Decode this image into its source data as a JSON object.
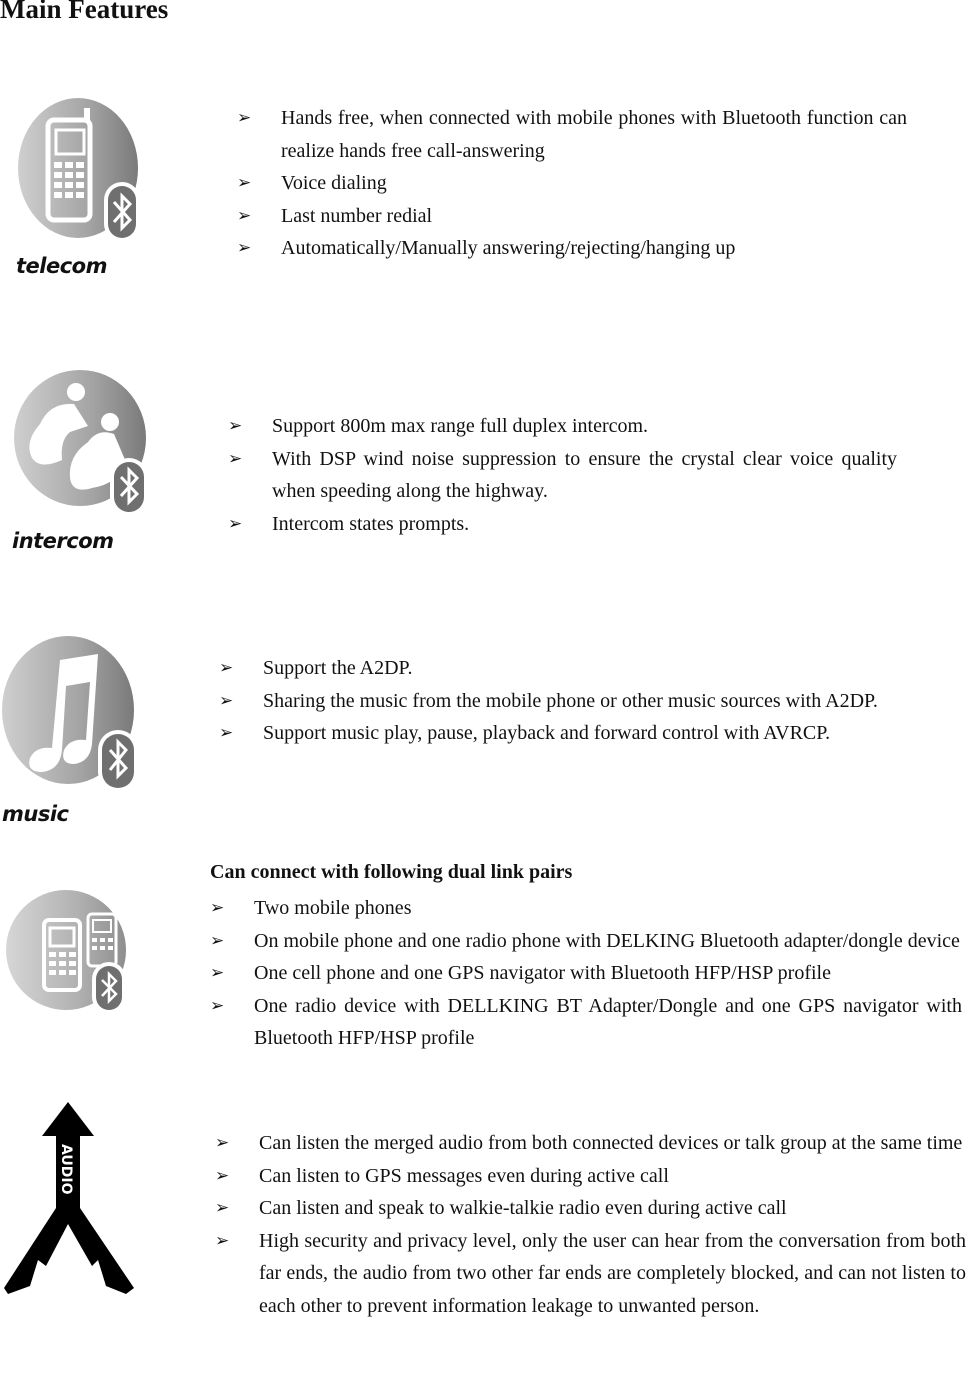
{
  "page": {
    "title": "Main Features"
  },
  "sections": [
    {
      "icon": "telecom-phone-bluetooth-icon",
      "icon_label": "telecom",
      "bullets": [
        "Hands free, when connected with mobile phones with Bluetooth function can realize hands free call-answering",
        "Voice dialing",
        "Last number redial",
        "Automatically/Manually answering/rejecting/hanging up"
      ]
    },
    {
      "icon": "intercom-riders-bluetooth-icon",
      "icon_label": "intercom",
      "bullets": [
        "Support 800m max range full duplex intercom.",
        "With DSP wind noise suppression to ensure the crystal clear voice quality when speeding along the highway.",
        "Intercom states prompts."
      ]
    },
    {
      "icon": "music-note-bluetooth-icon",
      "icon_label": "music",
      "bullets": [
        "Support the A2DP.",
        "Sharing the music from the mobile phone or other music sources with A2DP.",
        "Support music play, pause, playback and forward control with AVRCP."
      ]
    },
    {
      "icon": "dual-phones-bluetooth-icon",
      "heading": "Can connect with following dual link pairs",
      "bullets": [
        "Two mobile phones",
        "On mobile phone and one radio phone with DELKING Bluetooth adapter/dongle device",
        "One cell phone and one GPS navigator with Bluetooth HFP/HSP profile",
        "One radio device with DELLKING BT Adapter/Dongle and one GPS navigator with Bluetooth HFP/HSP profile"
      ]
    },
    {
      "icon": "audio-split-arrow-icon",
      "icon_text": "AUDIO",
      "bullets": [
        "Can listen the merged audio from both connected devices or talk group at the same time",
        "Can listen to GPS messages even during active call",
        "Can listen and speak to walkie-talkie radio even during active call",
        "High security and privacy level, only the user can hear from the conversation from both far ends, the audio from two other far ends are completely blocked, and can not listen to each other to prevent information leakage to unwanted person."
      ]
    }
  ],
  "bullet_glyph": "➢"
}
